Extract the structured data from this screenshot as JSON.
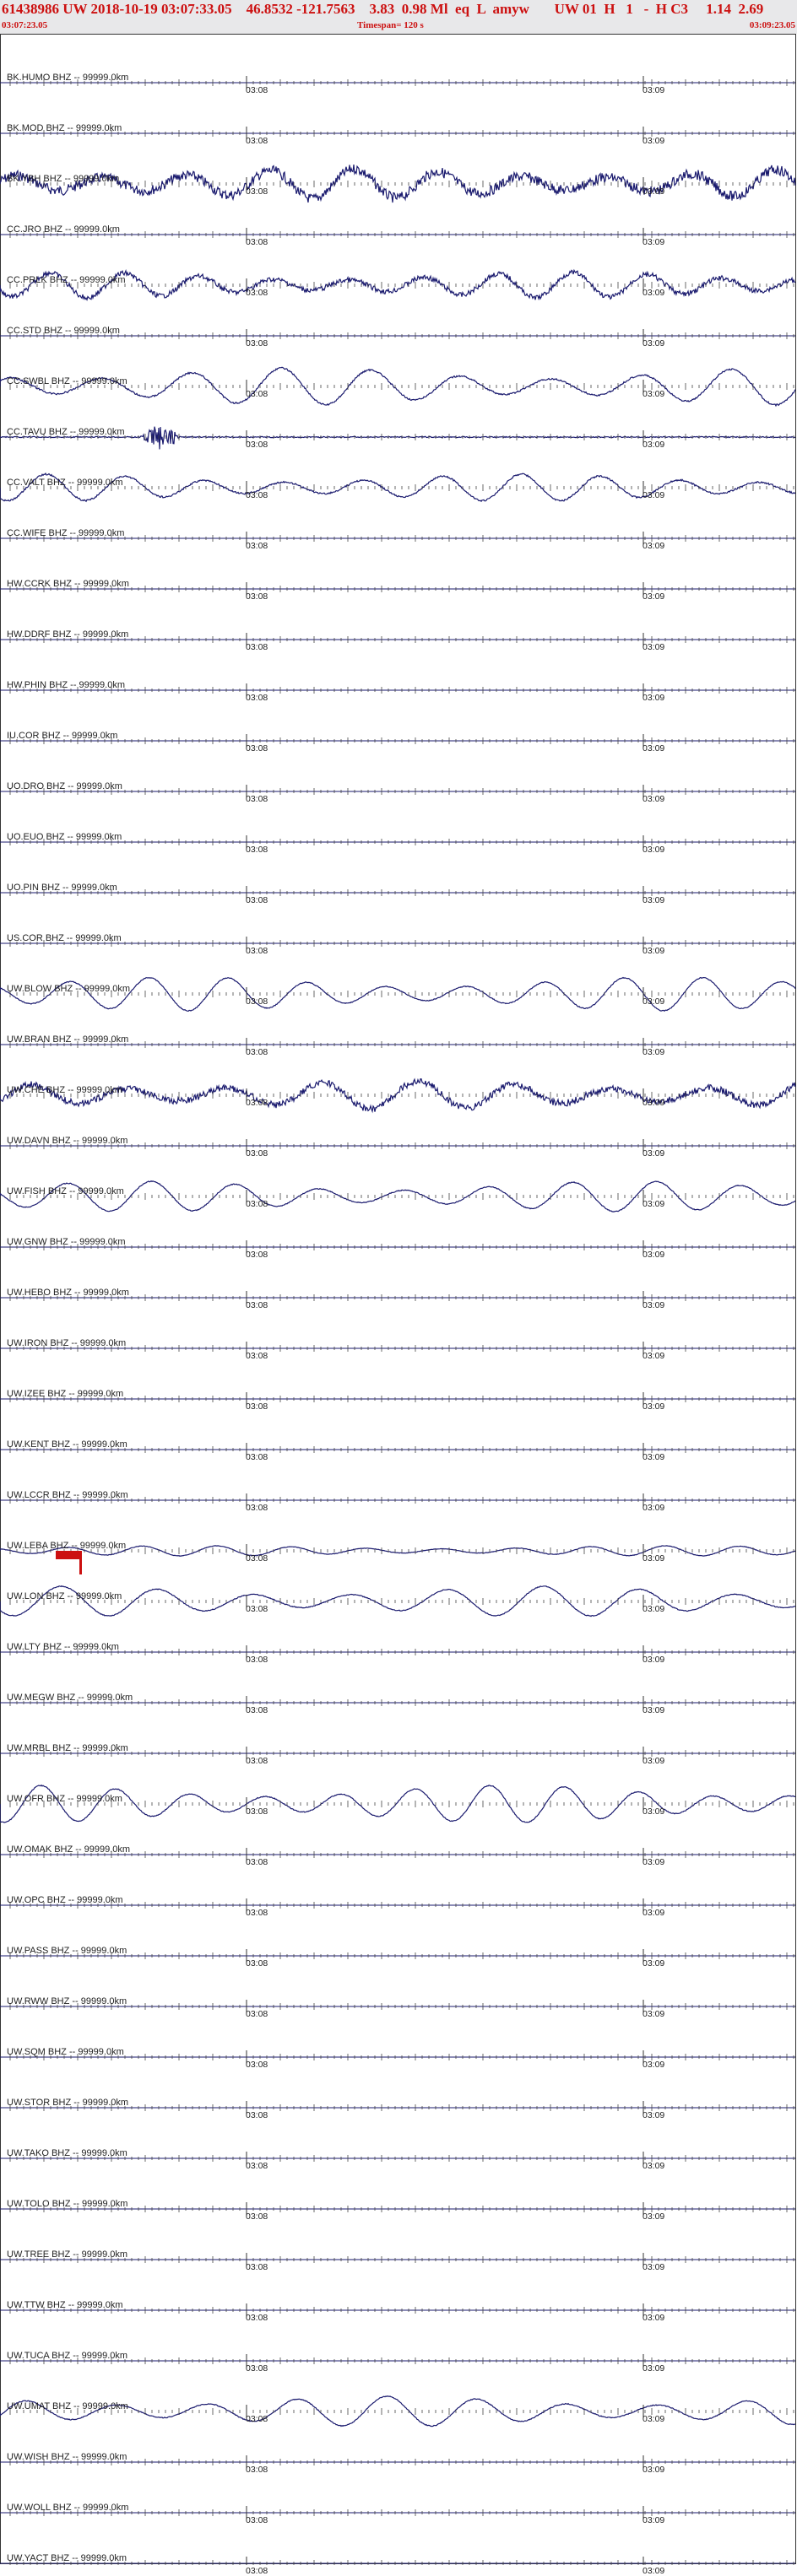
{
  "header": {
    "title_line": "61438986 UW 2018-10-19 03:07:33.05    46.8532 -121.7563    3.83  0.98 Ml  eq  L  amyw       UW 01  H   1   -  H C3     1.14  2.69",
    "start_time": "03:07:23.05",
    "timespan": "Timespan= 120 s",
    "end_time": "03:09:23.05"
  },
  "time_ticks": [
    "03:08",
    "03:09"
  ],
  "channels": [
    {
      "label": "BK.HUMO BHZ -- 99999.0km",
      "amp": 0
    },
    {
      "label": "BK.MOD BHZ -- 99999.0km",
      "amp": 0
    },
    {
      "label": "BK.YBH BHZ -- 99999.0km",
      "amp": 18,
      "noise": 6
    },
    {
      "label": "CC.JRO BHZ -- 99999.0km",
      "amp": 0
    },
    {
      "label": "CC.PRLK BHZ -- 99999.0km",
      "amp": 15,
      "noise": 3
    },
    {
      "label": "CC.STD BHZ -- 99999.0km",
      "amp": 0
    },
    {
      "label": "CC.SWBL BHZ -- 99999.0km",
      "amp": 22,
      "noise": 1
    },
    {
      "label": "CC.TAVU BHZ -- 99999.0km",
      "amp": 0,
      "burst": true
    },
    {
      "label": "CC.VALT BHZ -- 99999.0km",
      "amp": 16,
      "noise": 1
    },
    {
      "label": "CC.WIFE BHZ -- 99999.0km",
      "amp": 0
    },
    {
      "label": "HW.CCRK BHZ -- 99999.0km",
      "amp": 0
    },
    {
      "label": "HW.DDRF BHZ -- 99999.0km",
      "amp": 0
    },
    {
      "label": "HW.PHIN BHZ -- 99999.0km",
      "amp": 0
    },
    {
      "label": "IU.COR BHZ -- 99999.0km",
      "amp": 0
    },
    {
      "label": "UO.DRO BHZ -- 99999.0km",
      "amp": 0
    },
    {
      "label": "UO.EUO BHZ -- 99999.0km",
      "amp": 0
    },
    {
      "label": "UO.PIN BHZ -- 99999.0km",
      "amp": 0
    },
    {
      "label": "US.COR BHZ -- 99999.0km",
      "amp": 0
    },
    {
      "label": "UW.BLOW BHZ -- 99999.0km",
      "amp": 20,
      "noise": 0.5
    },
    {
      "label": "UW.BRAN BHZ -- 99999.0km",
      "amp": 0
    },
    {
      "label": "UW.CHE BHZ -- 99999.0km",
      "amp": 17,
      "noise": 4
    },
    {
      "label": "UW.DAVN BHZ -- 99999.0km",
      "amp": 0
    },
    {
      "label": "UW.FISH BHZ -- 99999.0km",
      "amp": 18,
      "noise": 0.5
    },
    {
      "label": "UW.GNW BHZ -- 99999.0km",
      "amp": 0
    },
    {
      "label": "UW.HEBO BHZ -- 99999.0km",
      "amp": 0
    },
    {
      "label": "UW.IRON BHZ -- 99999.0km",
      "amp": 0
    },
    {
      "label": "UW.IZEE BHZ -- 99999.0km",
      "amp": 0
    },
    {
      "label": "UW.KENT BHZ -- 99999.0km",
      "amp": 0
    },
    {
      "label": "UW.LCCR BHZ -- 99999.0km",
      "amp": 0
    },
    {
      "label": "UW.LEBA BHZ -- 99999.0km",
      "amp": 6,
      "noise": 0.3
    },
    {
      "label": "UW.LON BHZ -- 99999.0km",
      "amp": 18,
      "noise": 0.5
    },
    {
      "label": "UW.LTY BHZ -- 99999.0km",
      "amp": 0
    },
    {
      "label": "UW.MEGW BHZ -- 99999.0km",
      "amp": 0
    },
    {
      "label": "UW.MRBL BHZ -- 99999.0km",
      "amp": 0
    },
    {
      "label": "UW.OFR BHZ -- 99999.0km",
      "amp": 22,
      "noise": 0.5
    },
    {
      "label": "UW.OMAK BHZ -- 99999.0km",
      "amp": 0
    },
    {
      "label": "UW.OPC BHZ -- 99999.0km",
      "amp": 0
    },
    {
      "label": "UW.PASS BHZ -- 99999.0km",
      "amp": 0
    },
    {
      "label": "UW.RWW BHZ -- 99999.0km",
      "amp": 0
    },
    {
      "label": "UW.SQM BHZ -- 99999.0km",
      "amp": 0
    },
    {
      "label": "UW.STOR BHZ -- 99999.0km",
      "amp": 0
    },
    {
      "label": "UW.TAKO BHZ -- 99999.0km",
      "amp": 0
    },
    {
      "label": "UW.TOLO BHZ -- 99999.0km",
      "amp": 0
    },
    {
      "label": "UW.TREE BHZ -- 99999.0km",
      "amp": 0
    },
    {
      "label": "UW.TTW BHZ -- 99999.0km",
      "amp": 0
    },
    {
      "label": "UW.TUCA BHZ -- 99999.0km",
      "amp": 0
    },
    {
      "label": "UW.UMAT BHZ -- 99999.0km",
      "amp": 18,
      "noise": 0.5
    },
    {
      "label": "UW.WISH BHZ -- 99999.0km",
      "amp": 0
    },
    {
      "label": "UW.WOLL BHZ -- 99999.0km",
      "amp": 0
    },
    {
      "label": "UW.YACT BHZ -- 99999.0km",
      "amp": 0
    }
  ],
  "colors": {
    "trace": "#1a1a6e",
    "pick": "#cc1010",
    "header_text": "#cc1010",
    "header_bg": "#e8e8ea"
  }
}
